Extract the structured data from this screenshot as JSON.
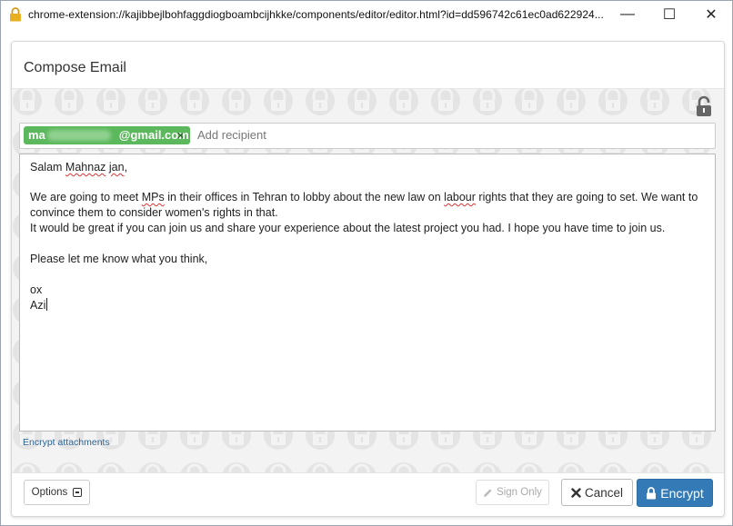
{
  "window": {
    "url": "chrome-extension://kajibbejlbohfaggdiogboambcijhkke/components/editor/editor.html?id=dd596742c61ec0ad622924...",
    "min_glyph": "—",
    "max_glyph": "☐",
    "close_glyph": "✕"
  },
  "panel": {
    "title": "Compose Email"
  },
  "recipients": {
    "chip_left": "ma",
    "chip_right": "@gmail.com",
    "chip_remove": "×",
    "placeholder": "Add recipient"
  },
  "editor": {
    "greeting_word1": "Salam",
    "greeting_word2": "Mahnaz",
    "greeting_word3": "jan",
    "greeting_punct": ",",
    "p1_a": "We are going to meet",
    "p1_mps": "MPs",
    "p1_b": "in their offices in Tehran to lobby about the new law on",
    "p1_labour": "labour",
    "p1_c": "rights that they are going to set. We want to",
    "p2": "convince them to consider women's rights in that.",
    "p3": "It would be great if you can join us and share your experience about the latest project you had. I hope you have time to join us.",
    "p4": "Please let me know what you think,",
    "sig1": "ox",
    "sig2": "Azi"
  },
  "encrypt_attachments": "Encrypt attachments",
  "footer": {
    "options": "Options",
    "sign_only": "Sign Only",
    "cancel": "Cancel",
    "encrypt": "Encrypt"
  }
}
